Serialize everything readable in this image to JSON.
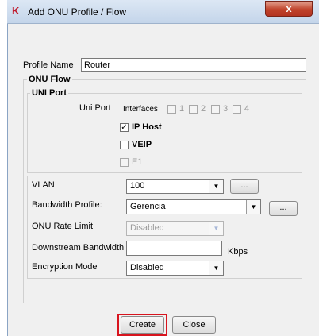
{
  "window": {
    "title": "Add ONU Profile / Flow",
    "logo": "K",
    "close_label": "x",
    "title_bar_color": "#c4d5ea",
    "close_color": "#c0432b"
  },
  "profile_name": {
    "label": "Profile Name",
    "value": "Router"
  },
  "onu_flow": {
    "legend": "ONU Flow"
  },
  "uni_port": {
    "legend": "UNI Port",
    "uni_port_label": "Uni Port",
    "interfaces_label": "Interfaces",
    "interfaces": [
      "1",
      "2",
      "3",
      "4"
    ],
    "ip_host": {
      "label": "IP Host",
      "checked": true,
      "check_mark": "✓"
    },
    "veip": {
      "label": "VEIP",
      "checked": false
    },
    "e1": {
      "label": "E1",
      "checked": false
    }
  },
  "form": {
    "vlan": {
      "label": "VLAN",
      "value": "100",
      "dots": "..."
    },
    "bandwidth_profile": {
      "label": "Bandwidth Profile:",
      "value": "Gerencia",
      "dots": "..."
    },
    "onu_rate_limit": {
      "label": "ONU Rate Limit",
      "value": "Disabled"
    },
    "downstream_bandwidth": {
      "label": "Downstream Bandwidth",
      "value": "",
      "unit": "Kbps"
    },
    "encryption_mode": {
      "label": "Encryption Mode",
      "value": "Disabled"
    }
  },
  "buttons": {
    "create": "Create",
    "close": "Close",
    "highlight_color": "#d8141e"
  }
}
